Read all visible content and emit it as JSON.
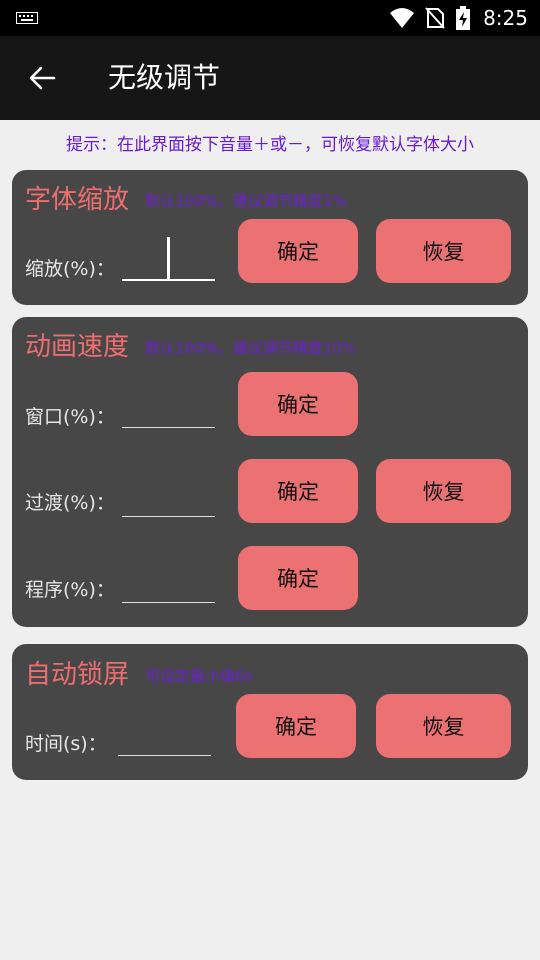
{
  "status": {
    "time": "8:25"
  },
  "appbar": {
    "title": "无级调节"
  },
  "hint": "提示：在此界面按下音量＋或－，可恢复默认字体大小",
  "font_card": {
    "title": "字体缩放",
    "subtitle": "默认100%，建议调节精度1%",
    "label": "缩放(%)：",
    "confirm": "确定",
    "restore": "恢复"
  },
  "anim_card": {
    "title": "动画速度",
    "subtitle": "默认100%，建议调节精度10%",
    "window_label": "窗口(%)：",
    "transition_label": "过渡(%)：",
    "program_label": "程序(%)：",
    "confirm": "确定",
    "restore": "恢复"
  },
  "lock_card": {
    "title": "自动锁屏",
    "subtitle": "可设定最小值6s",
    "label": "时间(s)：",
    "confirm": "确定",
    "restore": "恢复"
  }
}
